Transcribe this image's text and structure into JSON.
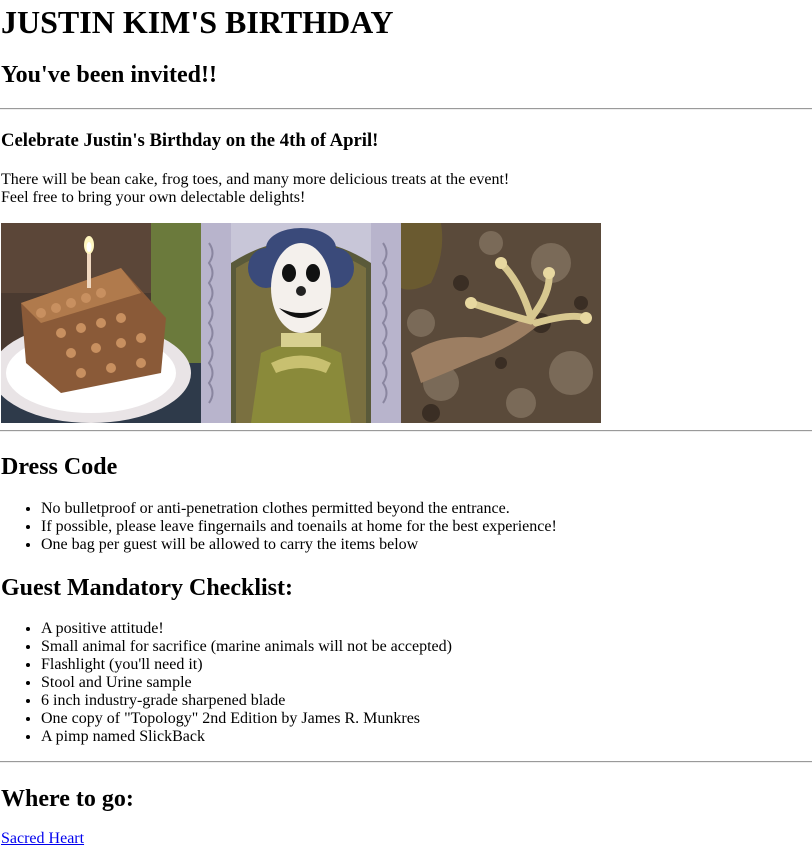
{
  "header": {
    "title": "JUSTIN KIM'S BIRTHDAY",
    "subtitle": "You've been invited!!"
  },
  "intro": {
    "heading": "Celebrate Justin's Birthday on the 4th of April!",
    "line1": "There will be bean cake, frog toes, and many more delicious treats at the event!",
    "line2": "Feel free to bring your own delectable delights!"
  },
  "photos": [
    {
      "name": "bean-cake-photo"
    },
    {
      "name": "clown-portrait-photo"
    },
    {
      "name": "frog-toes-photo"
    }
  ],
  "dress_code": {
    "heading": "Dress Code",
    "items": [
      "No bulletproof or anti-penetration clothes permitted beyond the entrance.",
      "If possible, please leave fingernails and toenails at home for the best experience!",
      "One bag per guest will be allowed to carry the items below"
    ]
  },
  "checklist": {
    "heading": "Guest Mandatory Checklist:",
    "items": [
      "A positive attitude!",
      "Small animal for sacrifice (marine animals will not be accepted)",
      "Flashlight (you'll need it)",
      "Stool and Urine sample",
      "6 inch industry-grade sharpened blade",
      "One copy of \"Topology\" 2nd Edition by James R. Munkres",
      "A pimp named SlickBack"
    ]
  },
  "location": {
    "heading": "Where to go:",
    "link_text": "Sacred Heart"
  },
  "colors": {
    "link": "#0000ee",
    "rule": "#9a9a9a"
  }
}
